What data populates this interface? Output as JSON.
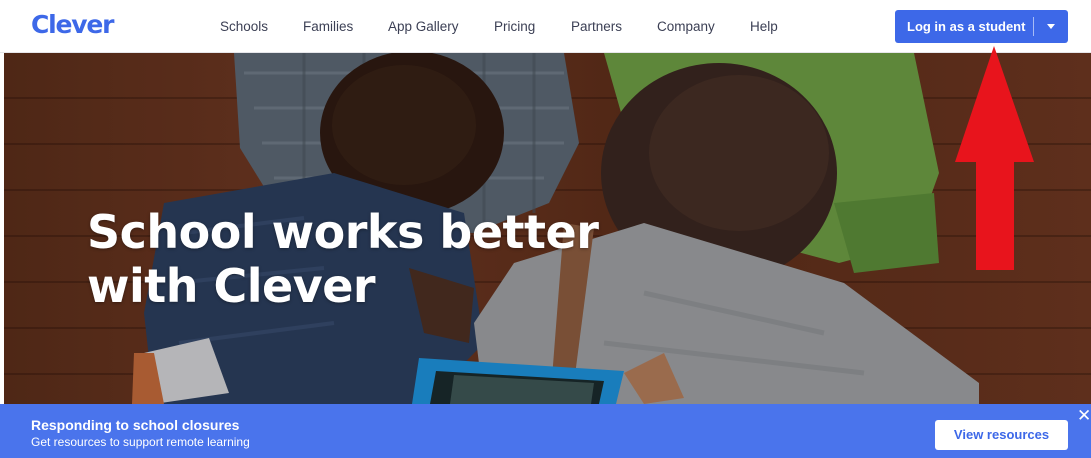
{
  "header": {
    "logo": "Clever",
    "nav": [
      {
        "label": "Schools"
      },
      {
        "label": "Families"
      },
      {
        "label": "App Gallery"
      },
      {
        "label": "Pricing"
      },
      {
        "label": "Partners"
      },
      {
        "label": "Company"
      },
      {
        "label": "Help"
      }
    ],
    "login_button": {
      "label": "Log in as a student",
      "dropdown_icon": "caret-down-icon"
    }
  },
  "hero": {
    "title_line1": "School works better",
    "title_line2": "with Clever",
    "image": "two-students-using-tablet-photo"
  },
  "annotation": {
    "icon": "red-up-arrow-icon",
    "color": "#e8141c"
  },
  "banner": {
    "title": "Responding to school closures",
    "subtitle": "Get resources to support remote learning",
    "button_label": "View resources",
    "close_icon": "close-icon"
  },
  "colors": {
    "brand": "#3d68e8",
    "banner": "#4a74ec",
    "nav_text": "#3b3f54",
    "annotation": "#e8141c"
  }
}
